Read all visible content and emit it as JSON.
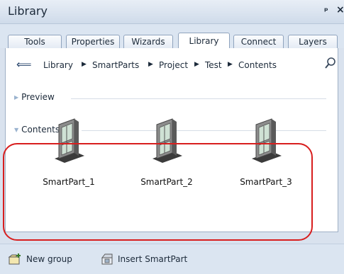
{
  "window": {
    "title": "Library",
    "pin_glyph": "ᵖ",
    "close_glyph": "×"
  },
  "tabs": [
    {
      "label": "Tools"
    },
    {
      "label": "Properties"
    },
    {
      "label": "Wizards"
    },
    {
      "label": "Library",
      "active": true
    },
    {
      "label": "Connect"
    },
    {
      "label": "Layers"
    }
  ],
  "breadcrumb": {
    "back_icon": "back-arrow-icon",
    "items": [
      "Library",
      "SmartParts",
      "Project",
      "Test",
      "Contents"
    ],
    "separator": "▶",
    "search_icon": "magnifier-icon"
  },
  "sections": {
    "preview_label": "Preview",
    "contents_label": "Contents"
  },
  "items": [
    {
      "label": "SmartPart_1",
      "icon": "window-smartpart-icon"
    },
    {
      "label": "SmartPart_2",
      "icon": "window-smartpart-icon"
    },
    {
      "label": "SmartPart_3",
      "icon": "window-smartpart-icon"
    }
  ],
  "highlight": {
    "color": "#d81e1e"
  },
  "bottombar": {
    "new_group_label": "New group",
    "insert_label": "Insert SmartPart"
  }
}
